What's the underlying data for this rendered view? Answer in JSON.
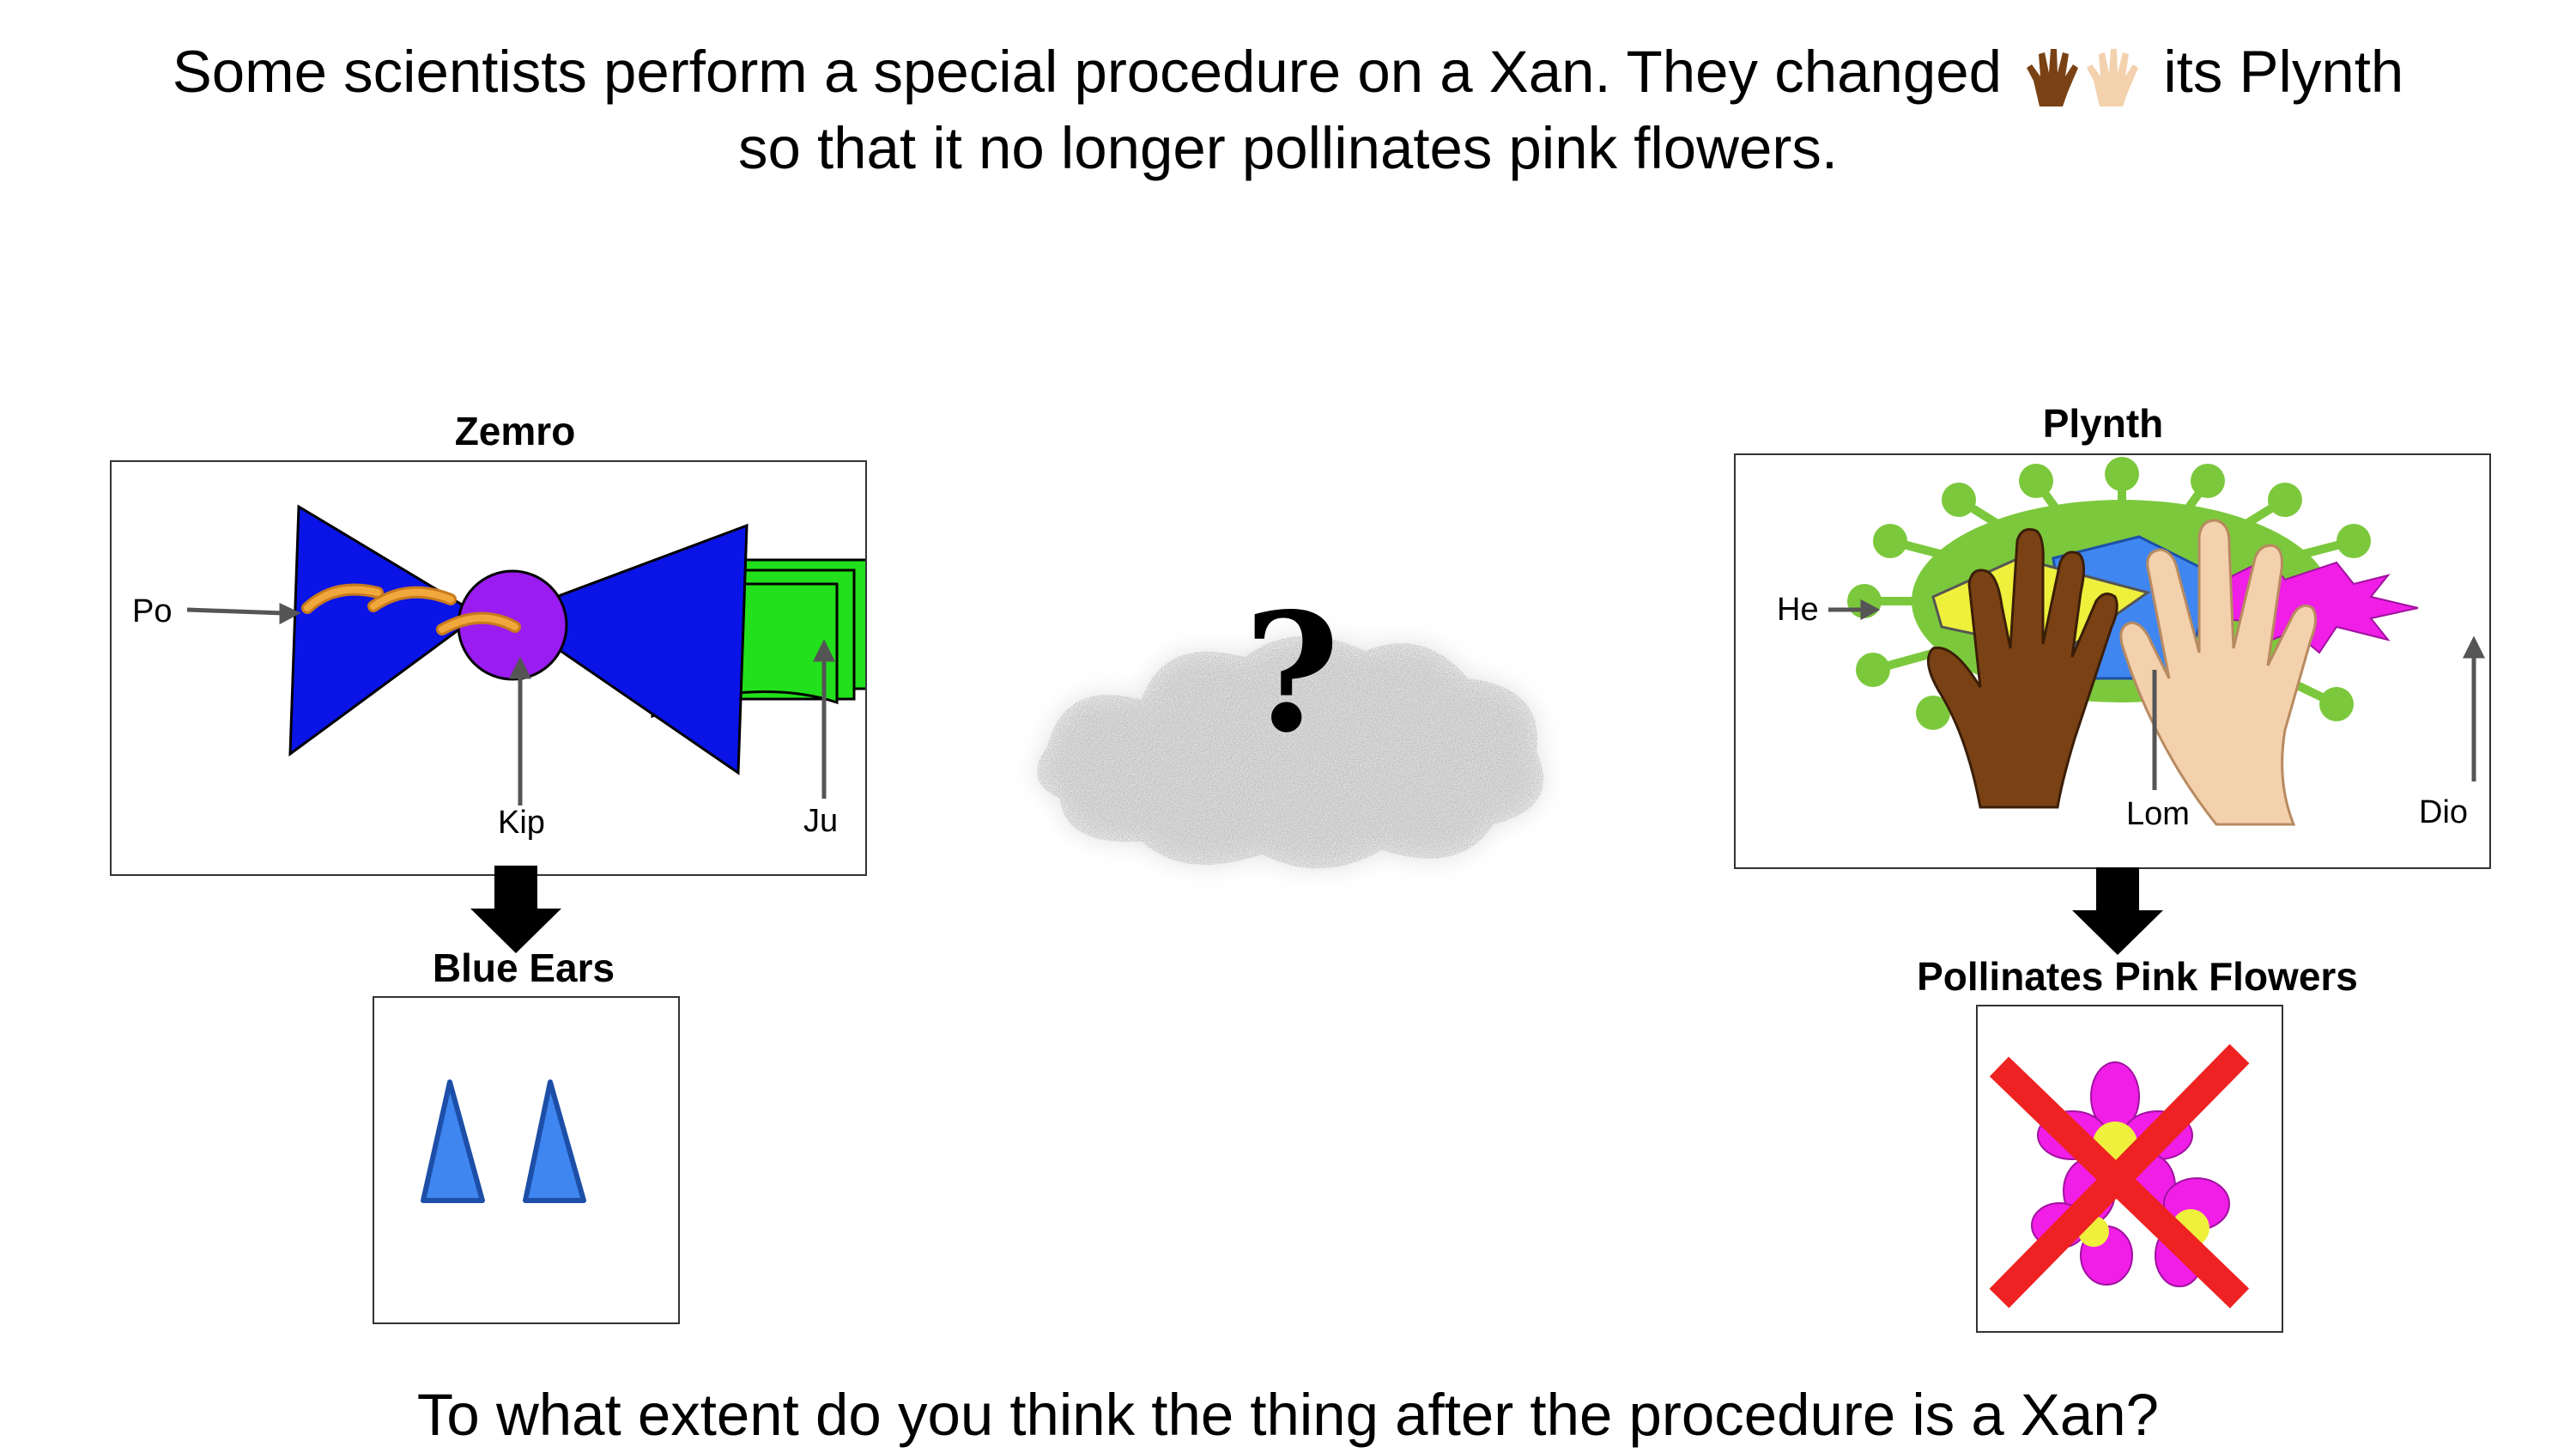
{
  "prompt": {
    "line1_part1": "Some scientists perform a special procedure on a Xan. They changed",
    "line1_part2": "its Plynth",
    "line2": "so that it no longer pollinates pink flowers.",
    "hand_icons": [
      "dark-hand-icon",
      "light-hand-icon"
    ]
  },
  "left": {
    "part_title": "Zemro",
    "labels": {
      "po": "Po",
      "kip": "Kip",
      "ju": "Ju"
    },
    "feature_title": "Blue Ears",
    "feature_icon": "blue-triangles-icon"
  },
  "middle": {
    "mystery_symbol": "?",
    "icon": "static-cloud-icon"
  },
  "right": {
    "part_title": "Plynth",
    "labels": {
      "he": "He",
      "lom": "Lom",
      "dio": "Dio"
    },
    "feature_title": "Pollinates Pink Flowers",
    "feature_icon": "crossed-out-pink-flower-icon"
  },
  "question": "To what extent do you think the thing after the procedure is a Xan?",
  "colors": {
    "bow_blue": "#0a14e6",
    "knot_purple": "#9a1cf0",
    "arc_orange": "#f0a83c",
    "paper_green": "#22e01c",
    "virus_green": "#7cc83c",
    "magenta": "#f01ee6",
    "ear_blue": "#3f86f0",
    "x_red": "#ee2222"
  }
}
